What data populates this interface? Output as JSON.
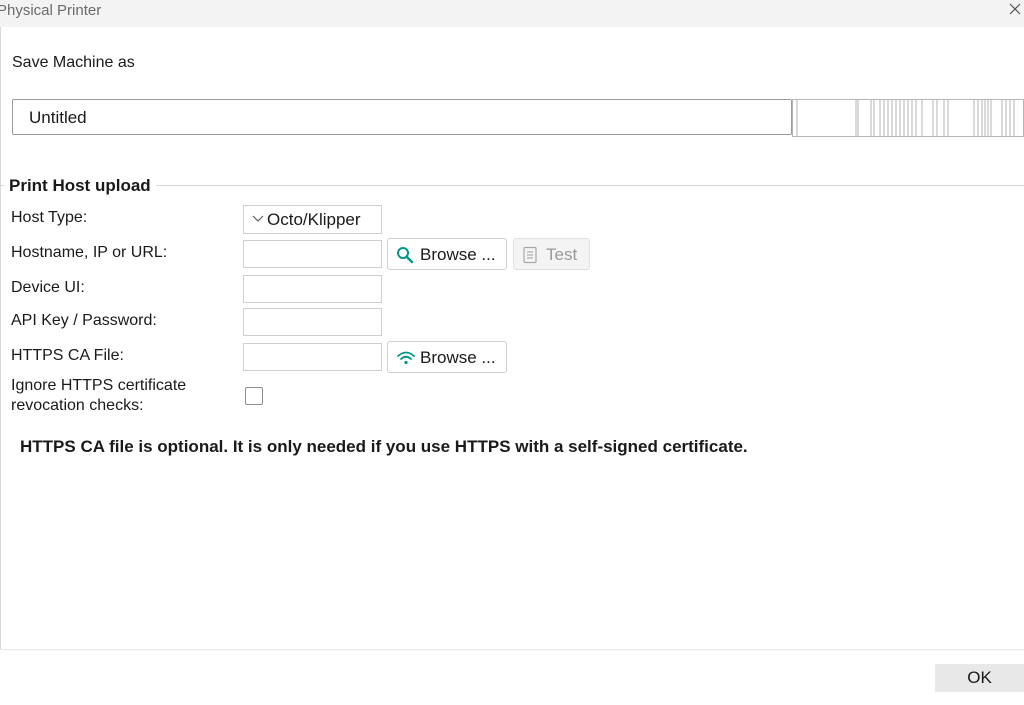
{
  "window": {
    "title": "Physical Printer"
  },
  "machine": {
    "save_label": "Save Machine as",
    "name_value": "Untitled"
  },
  "print_host": {
    "section_title": "Print Host upload",
    "host_type_label": "Host Type:",
    "host_type_value": "Octo/Klipper",
    "hostname_label": "Hostname, IP or URL:",
    "device_ui_label": "Device UI:",
    "api_key_label": "API Key / Password:",
    "https_ca_label": "HTTPS CA File:",
    "ignore_revocation_label_line1": "Ignore HTTPS certificate",
    "ignore_revocation_label_line2": "revocation checks:",
    "ignore_revocation_checked": false,
    "browse_label": "Browse ...",
    "test_label": "Test",
    "note": "HTTPS CA file is optional. It is only needed if you use HTTPS with a self-signed certificate."
  },
  "footer": {
    "ok_label": "OK"
  },
  "colors": {
    "accent": "#009688"
  }
}
